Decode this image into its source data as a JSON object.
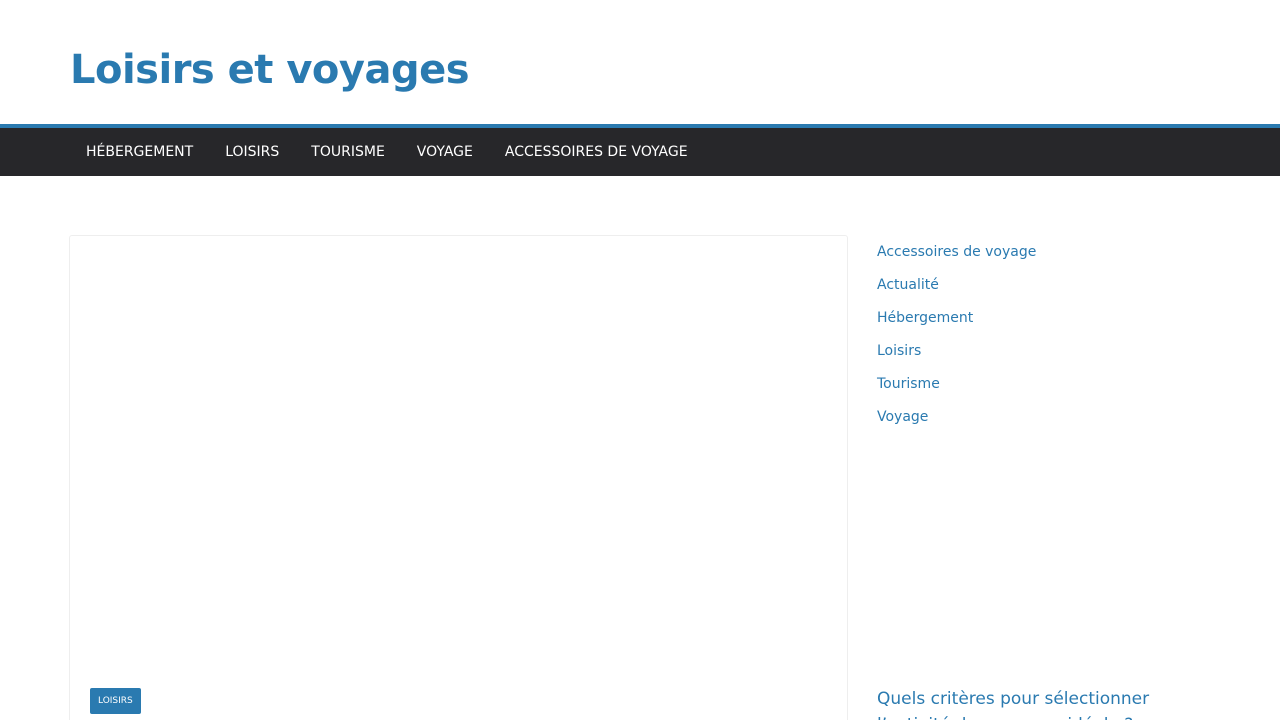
{
  "header": {
    "site_title": "Loisirs et voyages"
  },
  "nav": {
    "items": [
      {
        "label": "HÉBERGEMENT"
      },
      {
        "label": "LOISIRS"
      },
      {
        "label": "TOURISME"
      },
      {
        "label": "VOYAGE"
      },
      {
        "label": "ACCESSOIRES DE VOYAGE"
      }
    ]
  },
  "main": {
    "category_badge": "LOISIRS"
  },
  "sidebar": {
    "categories": [
      {
        "label": "Accessoires de voyage"
      },
      {
        "label": "Actualité"
      },
      {
        "label": "Hébergement"
      },
      {
        "label": "Loisirs"
      },
      {
        "label": "Tourisme"
      },
      {
        "label": "Voyage"
      }
    ],
    "post_title": "Quels critères pour sélectionner l’activité de vacances idéale ?"
  },
  "colors": {
    "accent": "#2a7ab0",
    "nav_background": "#27272a"
  }
}
